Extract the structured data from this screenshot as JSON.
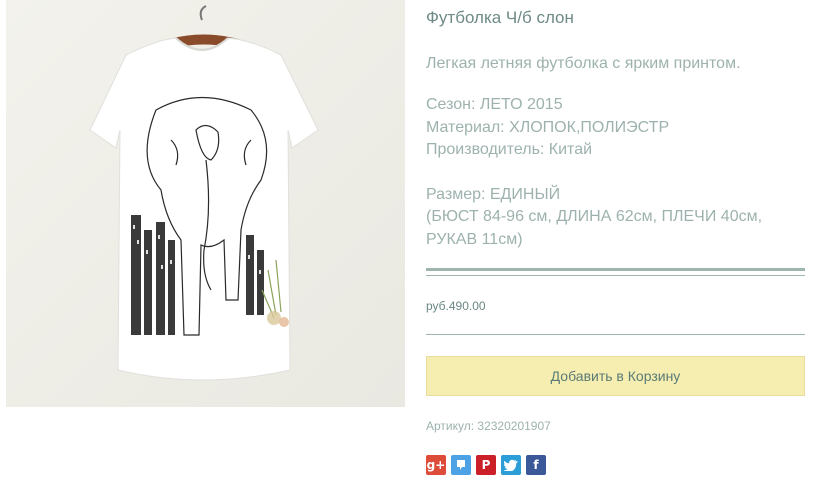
{
  "product": {
    "title": "Футболка Ч/б слон",
    "description": "Легкая летняя футболка с ярким принтом.",
    "season": "Сезон: ЛЕТО 2015",
    "material": "Материал: ХЛОПОК,ПОЛИЭСТР",
    "manufacturer": "Производитель: Китай",
    "size": "Размер: ЕДИНЫЙ",
    "size_details_1": "(БЮСТ 84-96 см, ДЛИНА 62см, ПЛЕЧИ 40см,",
    "size_details_2": "РУКАВ 11см)",
    "price": "руб.490.00",
    "add_to_cart": "Добавить в Корзину",
    "sku": "Артикул: 32320201907"
  },
  "social": [
    {
      "name": "google-plus-icon",
      "glyph": "g+",
      "color": "#dd4b39"
    },
    {
      "name": "odnoklassniki-icon",
      "glyph": "",
      "color": "#4ca2e5"
    },
    {
      "name": "pinterest-icon",
      "glyph": "P",
      "color": "#cb2027"
    },
    {
      "name": "twitter-icon",
      "glyph": "",
      "color": "#2b9ed8"
    },
    {
      "name": "facebook-icon",
      "glyph": "f",
      "color": "#3b5998"
    }
  ]
}
